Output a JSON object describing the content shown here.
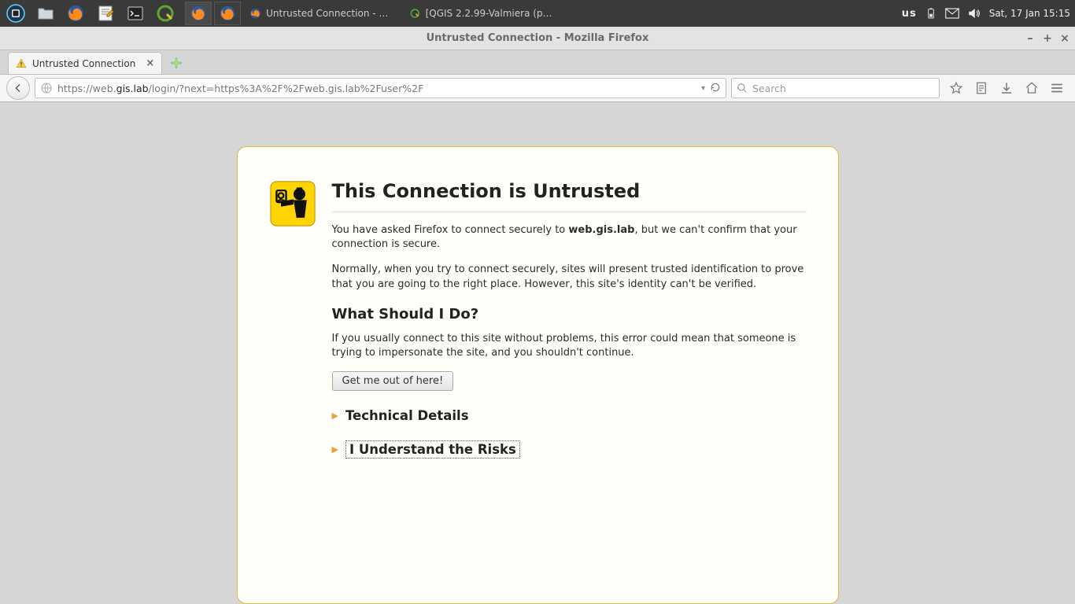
{
  "panel": {
    "kb_layout": "us",
    "datetime": "Sat, 17 Jan  15:15"
  },
  "taskbar": {
    "item1": "Untrusted Connection - Mo...",
    "item2": "[QGIS 2.2.99-Valmiera (ppa:..."
  },
  "window": {
    "title": "Untrusted Connection - Mozilla Firefox"
  },
  "tab": {
    "label": "Untrusted Connection"
  },
  "url": {
    "pre": "https://web.",
    "domain": "gis.lab",
    "post": "/login/?next=https%3A%2F%2Fweb.gis.lab%2Fuser%2F"
  },
  "search": {
    "placeholder": "Search"
  },
  "error": {
    "heading": "This Connection is Untrusted",
    "p1_pre": "You have asked Firefox to connect securely to ",
    "p1_host": "web.gis.lab",
    "p1_post": ", but we can't confirm that your connection is secure.",
    "p2": "Normally, when you try to connect securely, sites will present trusted identification to prove that you are going to the right place. However, this site's identity can't be verified.",
    "subheading": "What Should I Do?",
    "p3": "If you usually connect to this site without problems, this error could mean that someone is trying to impersonate the site, and you shouldn't continue.",
    "button": "Get me out of here!",
    "exp1": "Technical Details",
    "exp2": "I Understand the Risks"
  }
}
